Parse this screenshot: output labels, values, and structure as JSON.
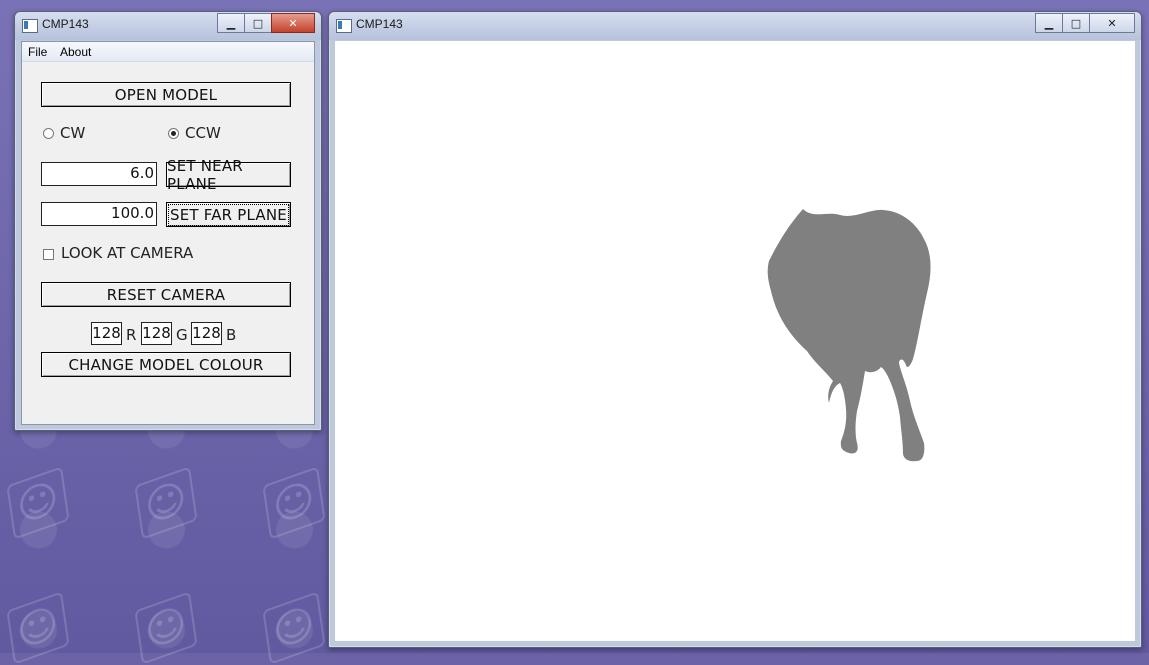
{
  "control_window": {
    "title": "CMP143",
    "menu": [
      {
        "label": "File"
      },
      {
        "label": "About"
      }
    ],
    "open_model_label": "OPEN MODEL",
    "winding": {
      "cw_label": "CW",
      "ccw_label": "CCW",
      "selected": "CCW"
    },
    "near_plane": {
      "value": "6.0",
      "button_label": "SET NEAR PLANE"
    },
    "far_plane": {
      "value": "100.0",
      "button_label": "SET FAR PLANE"
    },
    "look_at_camera": {
      "label": "LOOK AT CAMERA",
      "checked": false
    },
    "reset_camera_label": "RESET CAMERA",
    "colour": {
      "r_value": "128",
      "r_label": "R",
      "g_value": "128",
      "g_label": "G",
      "b_value": "128",
      "b_label": "B",
      "change_label": "CHANGE MODEL COLOUR"
    }
  },
  "render_window": {
    "title": "CMP143",
    "model_colour": "#808080"
  },
  "caption_buttons": {
    "minimize_icon": "minimize-icon",
    "maximize_icon": "maximize-icon",
    "close_icon": "close-icon"
  },
  "colors": {
    "desktop": "#6b63a6",
    "window_frame": "#bfc9dc",
    "panel": "#f0f0f0",
    "close_button": "#c4432e"
  }
}
